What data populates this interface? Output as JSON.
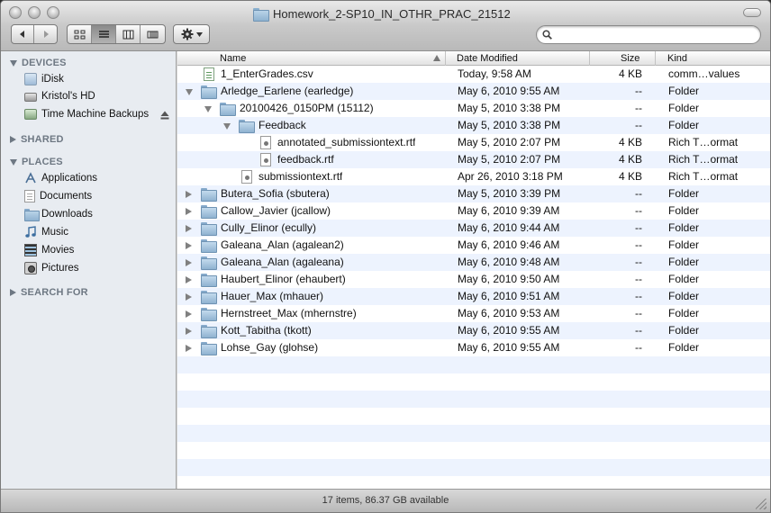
{
  "window": {
    "title": "Homework_2-SP10_IN_OTHR_PRAC_21512"
  },
  "search": {
    "placeholder": "",
    "value": ""
  },
  "sidebar": {
    "sections": {
      "devices": "DEVICES",
      "shared": "SHARED",
      "places": "PLACES",
      "search_for": "SEARCH FOR"
    },
    "devices": [
      {
        "label": "iDisk",
        "icon": "idisk-icon"
      },
      {
        "label": "Kristol's HD",
        "icon": "hard-drive-icon"
      },
      {
        "label": "Time Machine Backups",
        "icon": "time-machine-icon"
      }
    ],
    "places": [
      {
        "label": "Applications",
        "icon": "applications-icon"
      },
      {
        "label": "Documents",
        "icon": "documents-icon"
      },
      {
        "label": "Downloads",
        "icon": "folder-icon"
      },
      {
        "label": "Music",
        "icon": "music-icon"
      },
      {
        "label": "Movies",
        "icon": "movies-icon"
      },
      {
        "label": "Pictures",
        "icon": "pictures-icon"
      }
    ]
  },
  "columns": {
    "name": "Name",
    "date": "Date Modified",
    "size": "Size",
    "kind": "Kind"
  },
  "rows": [
    {
      "name": "1_EnterGrades.csv",
      "date": "Today, 9:58 AM",
      "size": "4 KB",
      "kind": "comm…values"
    },
    {
      "name": "Arledge_Earlene (earledge)",
      "date": "May 6, 2010 9:55 AM",
      "size": "--",
      "kind": "Folder"
    },
    {
      "name": "20100426_0150PM (15112)",
      "date": "May 5, 2010 3:38 PM",
      "size": "--",
      "kind": "Folder"
    },
    {
      "name": "Feedback",
      "date": "May 5, 2010 3:38 PM",
      "size": "--",
      "kind": "Folder"
    },
    {
      "name": "annotated_submissiontext.rtf",
      "date": "May 5, 2010 2:07 PM",
      "size": "4 KB",
      "kind": "Rich T…ormat"
    },
    {
      "name": "feedback.rtf",
      "date": "May 5, 2010 2:07 PM",
      "size": "4 KB",
      "kind": "Rich T…ormat"
    },
    {
      "name": "submissiontext.rtf",
      "date": "Apr 26, 2010 3:18 PM",
      "size": "4 KB",
      "kind": "Rich T…ormat"
    },
    {
      "name": "Butera_Sofia (sbutera)",
      "date": "May 5, 2010 3:39 PM",
      "size": "--",
      "kind": "Folder"
    },
    {
      "name": "Callow_Javier (jcallow)",
      "date": "May 6, 2010 9:39 AM",
      "size": "--",
      "kind": "Folder"
    },
    {
      "name": "Cully_Elinor (ecully)",
      "date": "May 6, 2010 9:44 AM",
      "size": "--",
      "kind": "Folder"
    },
    {
      "name": "Galeana_Alan (agalean2)",
      "date": "May 6, 2010 9:46 AM",
      "size": "--",
      "kind": "Folder"
    },
    {
      "name": "Galeana_Alan (agaleana)",
      "date": "May 6, 2010 9:48 AM",
      "size": "--",
      "kind": "Folder"
    },
    {
      "name": "Haubert_Elinor (ehaubert)",
      "date": "May 6, 2010 9:50 AM",
      "size": "--",
      "kind": "Folder"
    },
    {
      "name": "Hauer_Max (mhauer)",
      "date": "May 6, 2010 9:51 AM",
      "size": "--",
      "kind": "Folder"
    },
    {
      "name": "Hernstreet_Max (mhernstre)",
      "date": "May 6, 2010 9:53 AM",
      "size": "--",
      "kind": "Folder"
    },
    {
      "name": "Kott_Tabitha (tkott)",
      "date": "May 6, 2010 9:55 AM",
      "size": "--",
      "kind": "Folder"
    },
    {
      "name": "Lohse_Gay (glohse)",
      "date": "May 6, 2010 9:55 AM",
      "size": "--",
      "kind": "Folder"
    }
  ],
  "status": {
    "text": "17 items, 86.37 GB available"
  }
}
